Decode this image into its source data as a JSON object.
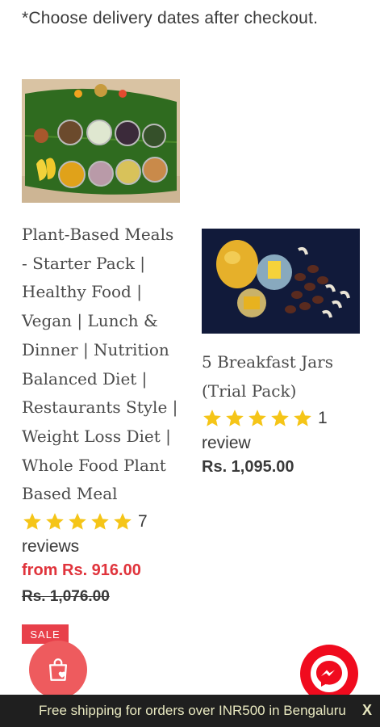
{
  "notice": "*Choose delivery dates after checkout.",
  "products": [
    {
      "title": "Plant-Based Meals - Starter Pack | Healthy Food | Vegan | Lunch & Dinner | Nutrition Balanced Diet | Restaurants Style | Weight Loss Diet | Whole Food Plant Based Meal",
      "rating": 5,
      "review_count": "7",
      "review_word": "reviews",
      "price": "from Rs. 916.00",
      "compare_price": "Rs. 1,076.00",
      "badge": "SALE",
      "price_color": "#e0343c"
    },
    {
      "title": "5 Breakfast Jars (Trial Pack)",
      "rating": 5,
      "review_count": "1",
      "review_word": "review",
      "price": "Rs. 1,095.00"
    }
  ],
  "shipping_bar": {
    "text": "Free shipping for orders over INR500 in Bengaluru",
    "close": "X"
  },
  "icons": {
    "wishlist": "shopping-bag-heart-icon",
    "messenger": "messenger-icon"
  },
  "colors": {
    "star": "#f5c518",
    "sale": "#e0343c",
    "wishlist_button": "#ee5b5e",
    "messenger_button": "#f00b1e",
    "shipping_bar": "#1f1f1f"
  }
}
